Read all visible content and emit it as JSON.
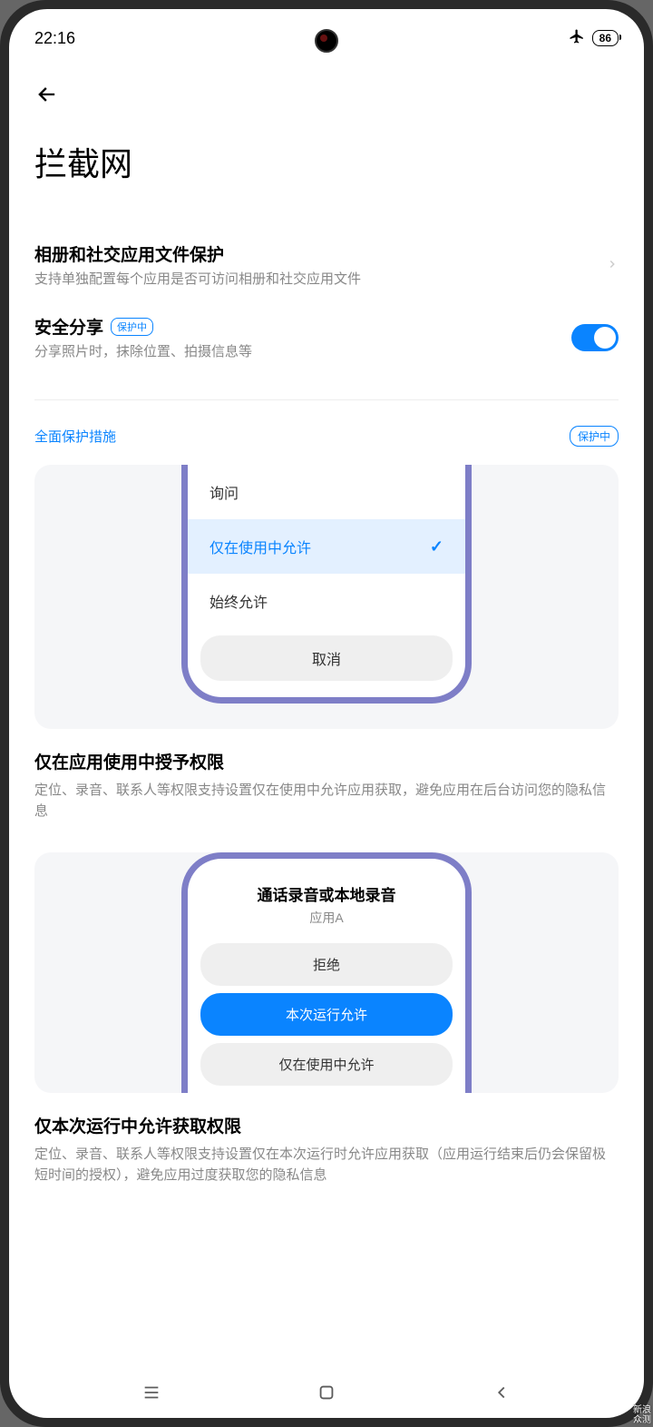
{
  "status": {
    "time": "22:16",
    "battery": "86"
  },
  "page": {
    "title": "拦截网"
  },
  "settings": {
    "gallery": {
      "title": "相册和社交应用文件保护",
      "desc": "支持单独配置每个应用是否可访问相册和社交应用文件"
    },
    "share": {
      "title": "安全分享",
      "badge": "保护中",
      "desc": "分享照片时，抹除位置、拍摄信息等"
    }
  },
  "section": {
    "label": "全面保护措施",
    "badge": "保护中"
  },
  "demo1": {
    "opt_ask": "询问",
    "opt_allow_use": "仅在使用中允许",
    "opt_always": "始终允许",
    "cancel": "取消"
  },
  "feature1": {
    "title": "仅在应用使用中授予权限",
    "desc": "定位、录音、联系人等权限支持设置仅在使用中允许应用获取，避免应用在后台访问您的隐私信息"
  },
  "demo2": {
    "perm_title": "通话录音或本地录音",
    "perm_app": "应用A",
    "btn_deny": "拒绝",
    "btn_once": "本次运行允许",
    "btn_inuse": "仅在使用中允许"
  },
  "feature2": {
    "title": "仅本次运行中允许获取权限",
    "desc": "定位、录音、联系人等权限支持设置仅在本次运行时允许应用获取（应用运行结束后仍会保留极短时间的授权），避免应用过度获取您的隐私信息"
  },
  "watermark": {
    "line1": "新浪",
    "line2": "众测"
  }
}
